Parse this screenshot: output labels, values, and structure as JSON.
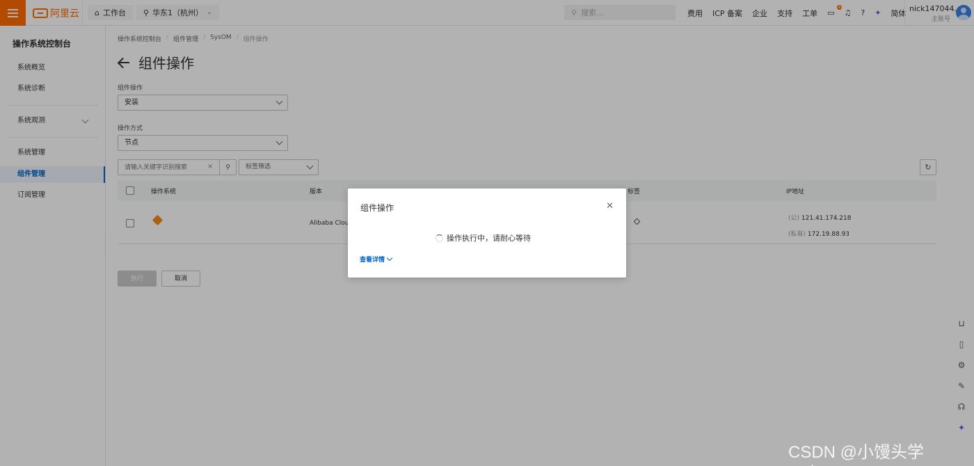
{
  "brand": {
    "logo_text": "阿里云",
    "color": "#ff6a00"
  },
  "topbar": {
    "workbench": "工作台",
    "region": "华东1（杭州）",
    "search_placeholder": "搜索...",
    "links": [
      "费用",
      "ICP 备案",
      "企业",
      "支持",
      "工单"
    ],
    "notification_count": "4",
    "language": "简体",
    "username": "nick147044...",
    "role": "主账号"
  },
  "sidebar": {
    "title": "操作系统控制台",
    "items": [
      {
        "label": "系统概览"
      },
      {
        "label": "系统诊断"
      },
      {
        "label": "系统观测"
      },
      {
        "label": "系统管理"
      },
      {
        "label": "组件管理"
      },
      {
        "label": "订阅管理"
      }
    ]
  },
  "breadcrumb": [
    "操作系统控制台",
    "组件管理",
    "SysOM",
    "组件操作"
  ],
  "page": {
    "title": "组件操作",
    "op_label": "组件操作",
    "op_value": "安装",
    "method_label": "操作方式",
    "method_value": "节点",
    "search_placeholder": "请输入关键字识别搜索",
    "tag_filter": "标签筛选"
  },
  "table": {
    "headers": {
      "os": "操作系统",
      "version": "版本",
      "tag": "标签",
      "ip": "IP地址"
    },
    "rows": [
      {
        "version": "Alibaba Cloud",
        "public_ip_type": "(公)",
        "public_ip": "121.41.174.218",
        "private_ip_type": "(私有)",
        "private_ip": "172.19.88.93"
      }
    ]
  },
  "actions": {
    "execute": "执行",
    "cancel": "取消"
  },
  "dialog": {
    "title": "组件操作",
    "message": "操作执行中，请耐心等待",
    "detail_link": "查看详情"
  },
  "watermark": "CSDN @小馒头学python"
}
